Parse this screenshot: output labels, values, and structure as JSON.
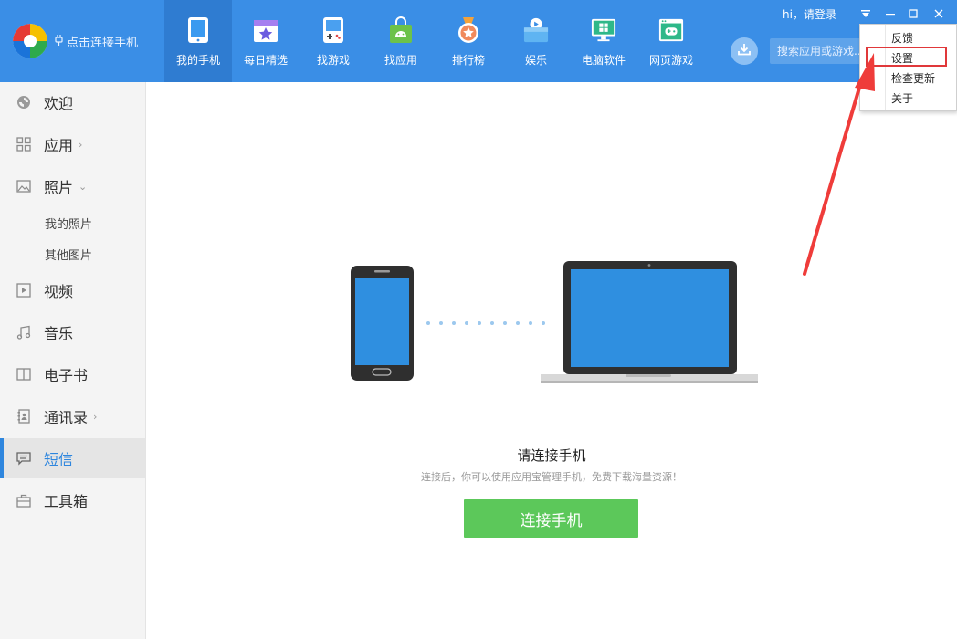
{
  "header": {
    "connect_label": "点击连接手机",
    "login_text": "hi，请登录",
    "search_placeholder": "搜索应用或游戏...",
    "nav": [
      {
        "label": "我的手机",
        "icon": "phone-icon"
      },
      {
        "label": "每日精选",
        "icon": "calendar-star-icon"
      },
      {
        "label": "找游戏",
        "icon": "gamepad-icon"
      },
      {
        "label": "找应用",
        "icon": "android-bag-icon"
      },
      {
        "label": "排行榜",
        "icon": "medal-icon"
      },
      {
        "label": "娱乐",
        "icon": "play-box-icon"
      },
      {
        "label": "电脑软件",
        "icon": "monitor-windows-icon"
      },
      {
        "label": "网页游戏",
        "icon": "browser-game-icon"
      }
    ],
    "window_controls": {
      "menu": "menu-dropdown-icon",
      "minimize": "minimize-icon",
      "maximize": "maximize-icon",
      "close": "close-icon"
    }
  },
  "menu": {
    "items": [
      "反馈",
      "设置",
      "检查更新",
      "关于"
    ],
    "highlighted": "设置"
  },
  "sidebar": {
    "items": [
      {
        "label": "欢迎",
        "icon": "welcome-icon"
      },
      {
        "label": "应用",
        "icon": "grid-icon",
        "chevron": "›"
      },
      {
        "label": "照片",
        "icon": "image-icon",
        "chevron": "⌄"
      },
      {
        "label": "视频",
        "icon": "video-icon"
      },
      {
        "label": "音乐",
        "icon": "music-icon"
      },
      {
        "label": "电子书",
        "icon": "book-icon"
      },
      {
        "label": "通讯录",
        "icon": "contacts-icon",
        "chevron": "›"
      },
      {
        "label": "短信",
        "icon": "message-icon",
        "active": true
      },
      {
        "label": "工具箱",
        "icon": "toolbox-icon"
      }
    ],
    "photo_subitems": [
      "我的照片",
      "其他图片"
    ]
  },
  "main": {
    "title": "请连接手机",
    "subtitle": "连接后，你可以使用应用宝管理手机，免费下载海量资源！",
    "button_label": "连接手机"
  },
  "colors": {
    "header_bg": "#3a8ee6",
    "nav_active_bg": "#2f7cd1",
    "accent": "#2e86de",
    "connect_button": "#5cc85a",
    "highlight_border": "#e0383a",
    "arrow": "#ef3c3a"
  }
}
